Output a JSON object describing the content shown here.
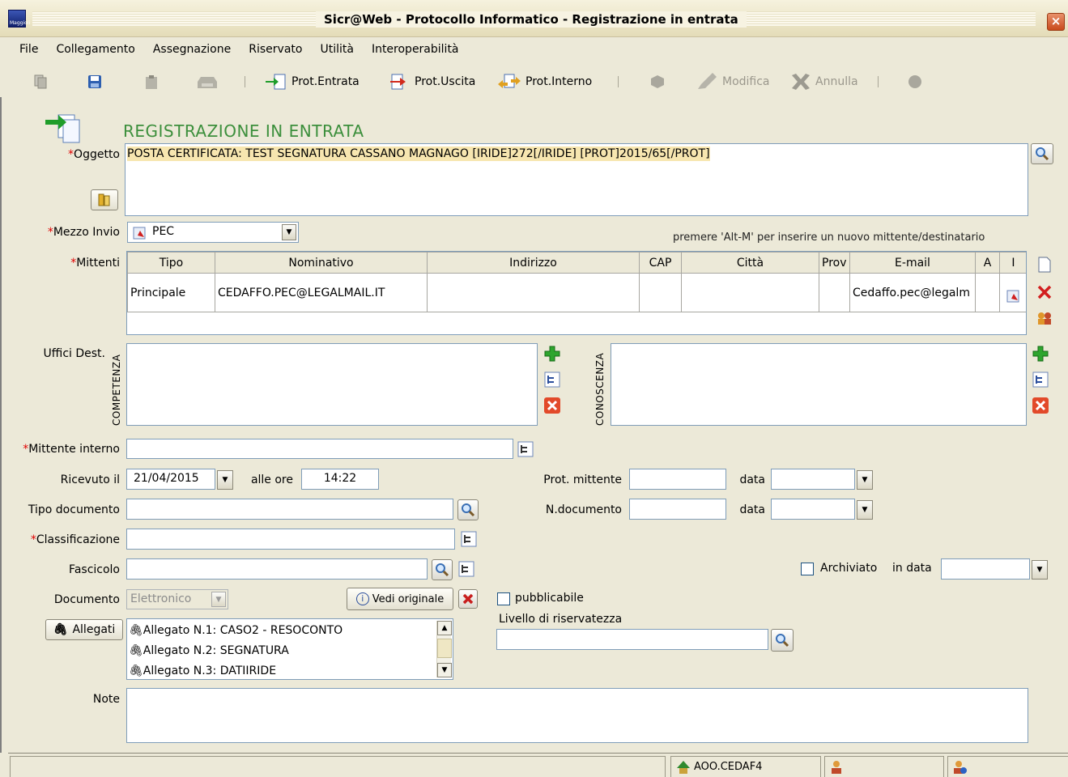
{
  "window": {
    "title": "Sicr@Web - Protocollo Informatico - Registrazione in entrata",
    "close": "×"
  },
  "menu": [
    "File",
    "Collegamento",
    "Assegnazione",
    "Riservato",
    "Utilità",
    "Interoperabilità"
  ],
  "toolbar": {
    "prot_entrata": "Prot.Entrata",
    "prot_uscita": "Prot.Uscita",
    "prot_interno": "Prot.Interno",
    "modifica": "Modifica",
    "annulla": "Annulla"
  },
  "form": {
    "section_title": "REGISTRAZIONE IN ENTRATA",
    "oggetto_label": "Oggetto",
    "oggetto_value": "POSTA CERTIFICATA: TEST SEGNATURA CASSANO MAGNAGO [IRIDE]272[/IRIDE] [PROT]2015/65[/PROT]",
    "mezzo_invio_label": "Mezzo Invio",
    "mezzo_invio_value": "PEC",
    "alt_m_hint": "premere 'Alt-M' per inserire un nuovo mittente/destinatario",
    "mittenti_label": "Mittenti",
    "mittenti_columns": [
      "Tipo",
      "Nominativo",
      "Indirizzo",
      "CAP",
      "Città",
      "Prov",
      "E-mail",
      "A",
      "I"
    ],
    "mittenti_rows": [
      {
        "tipo": "Principale",
        "nominativo": "CEDAFFO.PEC@LEGALMAIL.IT",
        "indirizzo": "",
        "cap": "",
        "citta": "",
        "prov": "",
        "email": "Cedaffo.pec@legalm"
      }
    ],
    "uffici_dest_label": "Uffici Dest.",
    "competenza": "COMPETENZA",
    "conoscenza": "CONOSCENZA",
    "mittente_interno_label": "Mittente interno",
    "ricevuto_il_label": "Ricevuto il",
    "ricevuto_il_value": "21/04/2015",
    "alle_ore_label": "alle ore",
    "alle_ore_value": "14:22",
    "prot_mittente_label": "Prot. mittente",
    "data_label": "data",
    "tipo_documento_label": "Tipo documento",
    "n_documento_label": "N.documento",
    "classificazione_label": "Classificazione",
    "fascicolo_label": "Fascicolo",
    "archiviato_label": "Archiviato",
    "in_data_label": "in data",
    "documento_label": "Documento",
    "documento_value": "Elettronico",
    "vedi_originale": "Vedi originale",
    "pubblicabile_label": "pubblicabile",
    "allegati_button": "Allegati",
    "allegati": [
      "Allegato N.1: CASO2 - RESOCONTO",
      "Allegato N.2: SEGNATURA",
      "Allegato N.3: DATIIRIDE"
    ],
    "livello_riservatezza_label": "Livello di riservatezza",
    "note_label": "Note"
  },
  "status": {
    "aoo": "AOO.CEDAF4"
  },
  "colors": {
    "highlight": "#f7e6b0",
    "section_title": "#3c8f3c",
    "required": "#e00000"
  }
}
